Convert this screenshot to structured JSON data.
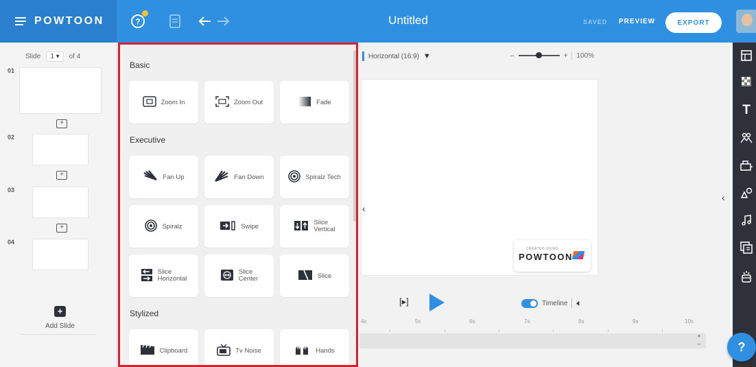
{
  "app": {
    "logo": "POWTOON",
    "title": "Untitled",
    "status": "SAVED",
    "preview_label": "PREVIEW",
    "export_label": "EXPORT"
  },
  "slides_panel": {
    "slide_label": "Slide",
    "current_slide": "1",
    "of_label": "of 4",
    "slides": [
      {
        "number": "01"
      },
      {
        "number": "02"
      },
      {
        "number": "03"
      },
      {
        "number": "04"
      }
    ],
    "add_slide_label": "Add Slide"
  },
  "transitions": {
    "sections": [
      {
        "title": "Basic",
        "items": [
          {
            "label": "Zoom In",
            "icon": "zoom-in-icon"
          },
          {
            "label": "Zoom Out",
            "icon": "zoom-out-icon"
          },
          {
            "label": "Fade",
            "icon": "fade-icon"
          }
        ]
      },
      {
        "title": "Executive",
        "items": [
          {
            "label": "Fan Up",
            "icon": "fan-up-icon"
          },
          {
            "label": "Fan Down",
            "icon": "fan-down-icon"
          },
          {
            "label": "Spiralz Tech",
            "icon": "spiral-icon"
          },
          {
            "label": "Spiralz",
            "icon": "spiral-icon"
          },
          {
            "label": "Swipe",
            "icon": "swipe-icon"
          },
          {
            "label": "Slice Vertical",
            "line1": "Slice",
            "line2": "Vertical",
            "icon": "slice-vertical-icon"
          },
          {
            "label": "Slice Horizontal",
            "line1": "Slice",
            "line2": "Horizontal",
            "icon": "slice-horizontal-icon"
          },
          {
            "label": "Slice Center",
            "line1": "Slice",
            "line2": "Center",
            "icon": "slice-center-icon"
          },
          {
            "label": "Slice",
            "icon": "slice-icon"
          }
        ]
      },
      {
        "title": "Stylized",
        "items": [
          {
            "label": "Clipboard",
            "icon": "clipboard-icon"
          },
          {
            "label": "Tv Noise",
            "icon": "tv-icon"
          },
          {
            "label": "Hands",
            "icon": "hands-icon"
          }
        ]
      }
    ]
  },
  "stage": {
    "aspect_ratio": "Horizontal (16:9)",
    "zoom_minus": "–",
    "zoom_plus": "+",
    "zoom_level": "100%",
    "zoom_fraction": 0.5,
    "badge_caption": "CREATED USING",
    "badge_logo": "POWTOON"
  },
  "timeline": {
    "frame_label": "[▸]",
    "toggle_label": "Timeline",
    "toggle_on": true,
    "ticks": [
      "4s",
      "5s",
      "6s",
      "7s",
      "8s",
      "9s",
      "10s"
    ]
  },
  "help_label": "?",
  "colors": {
    "brand_blue": "#2f8fe0",
    "highlight_red": "#d62030",
    "toolbar_dark": "#2e3238"
  }
}
